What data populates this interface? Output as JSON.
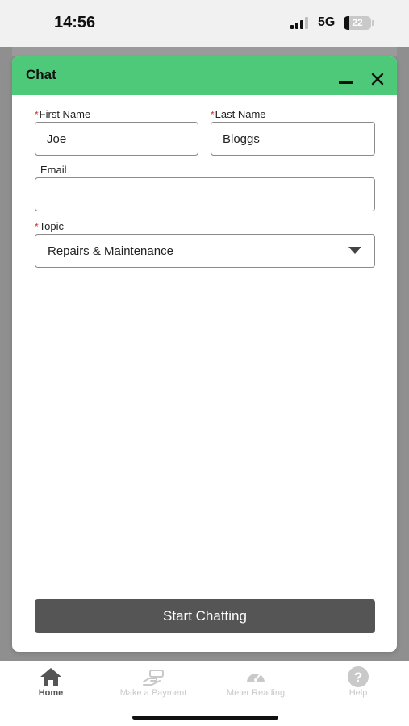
{
  "status_bar": {
    "time": "14:56",
    "network": "5G",
    "battery_level": "22",
    "battery_fraction": 0.22
  },
  "chat": {
    "title": "Chat",
    "form": {
      "first_name": {
        "label": "First Name",
        "required_mark": "*",
        "value": "Joe"
      },
      "last_name": {
        "label": "Last Name",
        "required_mark": "*",
        "value": "Bloggs"
      },
      "email": {
        "label": "Email",
        "value": ""
      },
      "topic": {
        "label": "Topic",
        "required_mark": "*",
        "selected": "Repairs & Maintenance"
      }
    },
    "start_button": "Start Chatting"
  },
  "bottom_nav": {
    "items": [
      {
        "label": "Home",
        "icon": "home-icon",
        "active": true
      },
      {
        "label": "Make a Payment",
        "icon": "payment-hand-icon",
        "active": false
      },
      {
        "label": "Meter Reading",
        "icon": "gauge-icon",
        "active": false
      },
      {
        "label": "Help",
        "icon": "help-icon",
        "active": false
      }
    ]
  },
  "colors": {
    "header_green": "#4ec97a",
    "button_gray": "#555555",
    "required_red": "#d32f2f",
    "nav_inactive": "#c9c9c9"
  }
}
